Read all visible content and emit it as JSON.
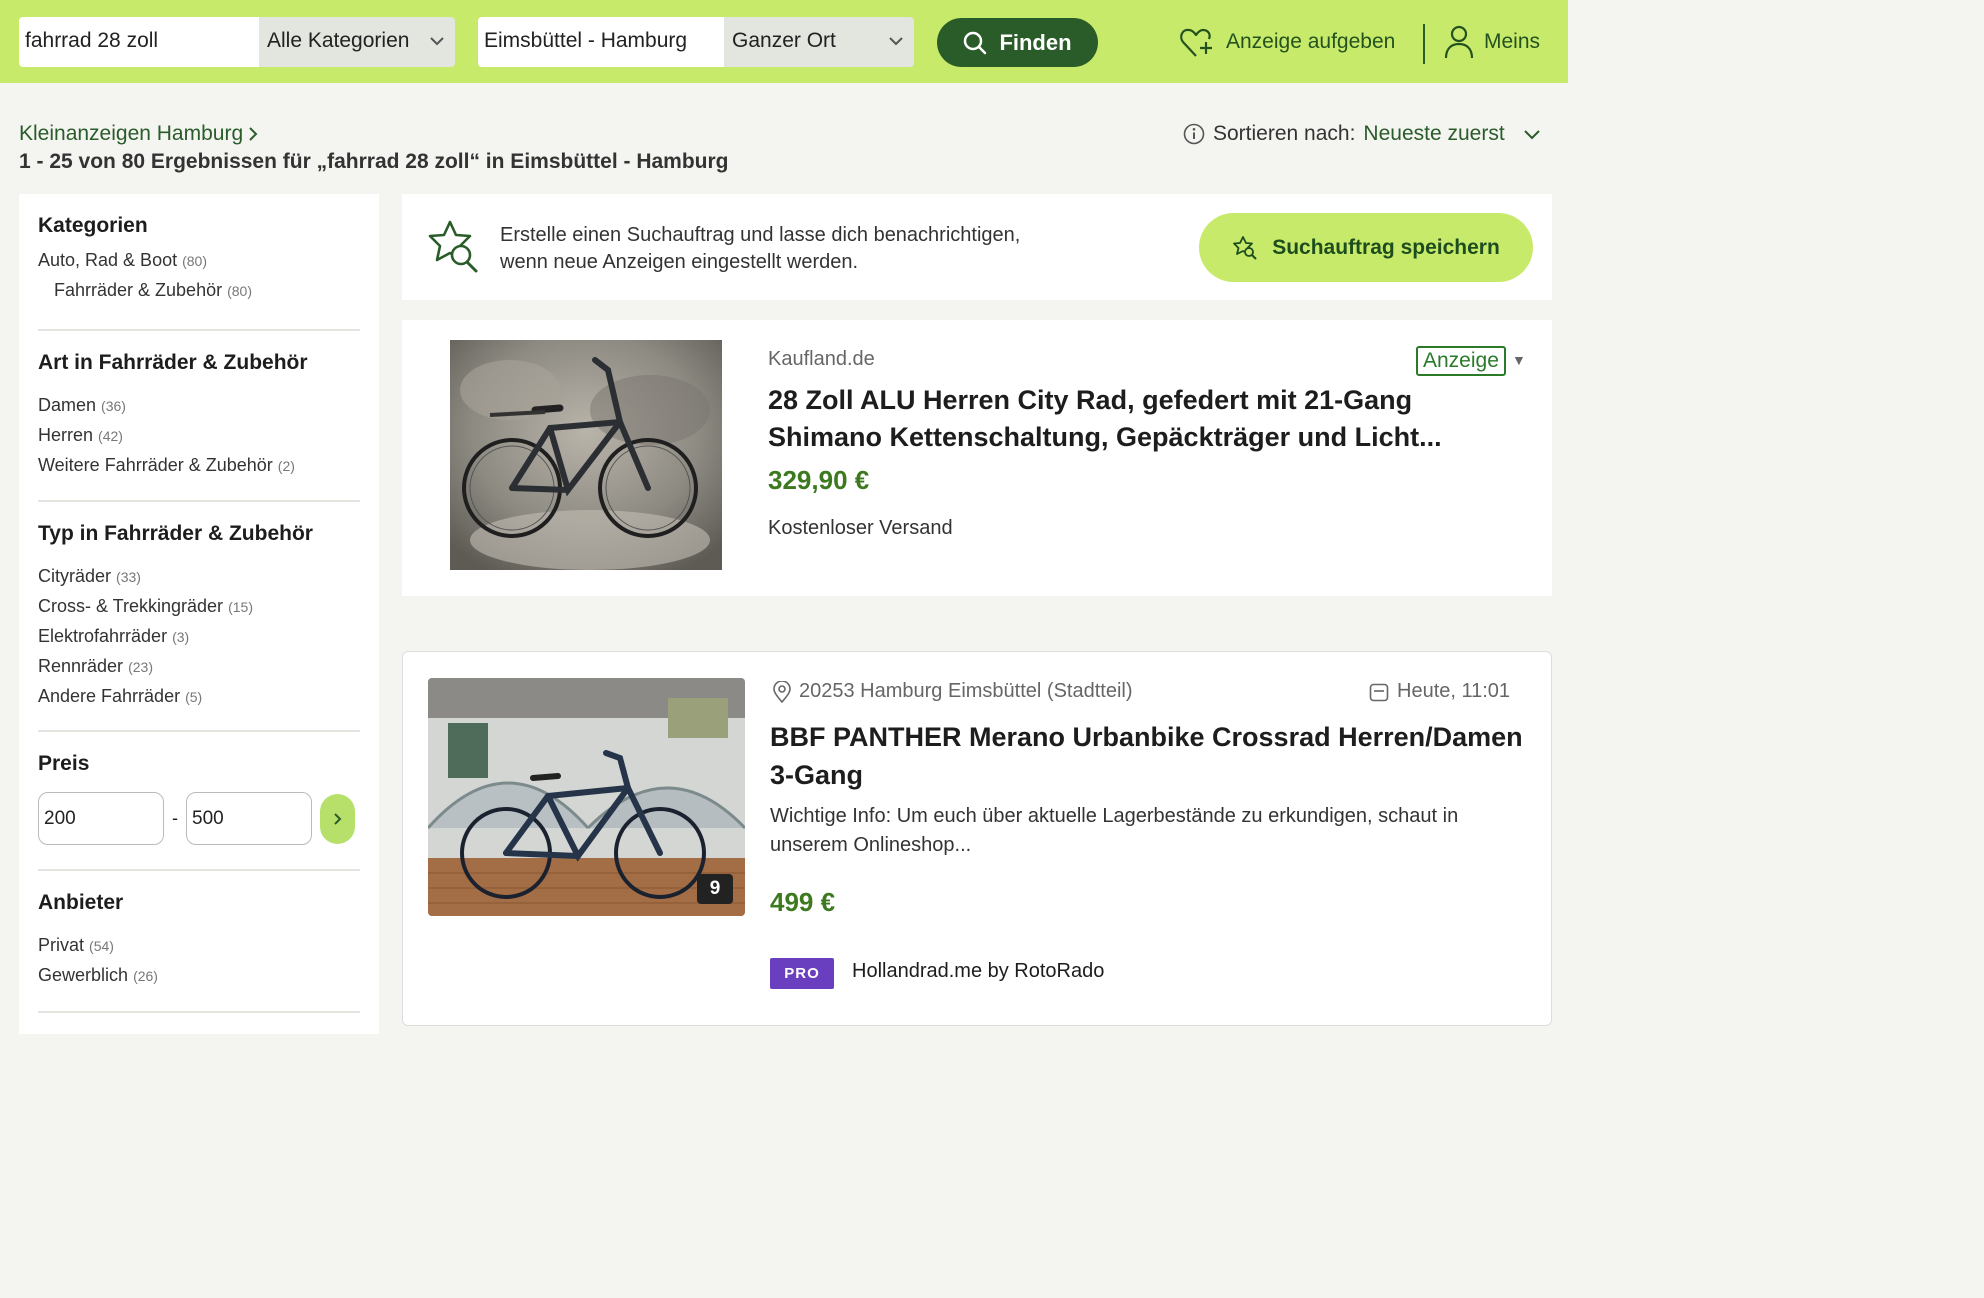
{
  "header": {
    "search_value": "fahrrad 28 zoll",
    "category": "Alle Kategorien",
    "location": "Eimsbüttel - Hamburg",
    "radius": "Ganzer Ort",
    "find_label": "Finden",
    "post_ad_label": "Anzeige aufgeben",
    "account_label": "Meins"
  },
  "breadcrumb": {
    "link": "Kleinanzeigen Hamburg",
    "result_title": "1 - 25 von 80 Ergebnissen für „fahrrad 28 zoll“ in Eimsbüttel - Hamburg"
  },
  "sort": {
    "label": "Sortieren nach:",
    "value": "Neueste zuerst"
  },
  "sidebar": {
    "categories": {
      "title": "Kategorien",
      "items": [
        {
          "label": "Auto, Rad & Boot",
          "count": "(80)"
        },
        {
          "label": "Fahrräder & Zubehör",
          "count": "(80)"
        }
      ]
    },
    "art": {
      "title": "Art in Fahrräder & Zubehör",
      "items": [
        {
          "label": "Damen",
          "count": "(36)"
        },
        {
          "label": "Herren",
          "count": "(42)"
        },
        {
          "label": "Weitere Fahrräder & Zubehör",
          "count": "(2)"
        }
      ]
    },
    "typ": {
      "title": "Typ in Fahrräder & Zubehör",
      "items": [
        {
          "label": "Cityräder",
          "count": "(33)"
        },
        {
          "label": "Cross- & Trekkingräder",
          "count": "(15)"
        },
        {
          "label": "Elektrofahrräder",
          "count": "(3)"
        },
        {
          "label": "Rennräder",
          "count": "(23)"
        },
        {
          "label": "Andere Fahrräder",
          "count": "(5)"
        }
      ]
    },
    "price": {
      "title": "Preis",
      "min": "200",
      "sep": "-",
      "max": "500"
    },
    "seller": {
      "title": "Anbieter",
      "items": [
        {
          "label": "Privat",
          "count": "(54)"
        },
        {
          "label": "Gewerblich",
          "count": "(26)"
        }
      ]
    }
  },
  "alert": {
    "line1": "Erstelle einen Suchauftrag und lasse dich benachrichtigen,",
    "line2": "wenn neue Anzeigen eingestellt werden.",
    "button": "Suchauftrag speichern"
  },
  "ad": {
    "seller": "Kaufland.de",
    "badge": "Anzeige",
    "title": "28 Zoll ALU Herren City Rad, gefedert mit 21-Gang Shimano Kettenschaltung, Gepäckträger und Licht...",
    "price": "329,90 €",
    "shipping": "Kostenloser Versand"
  },
  "listing": {
    "location": "20253 Hamburg Eimsbüttel (Stadtteil)",
    "date": "Heute, 11:01",
    "title": "BBF PANTHER Merano Urbanbike Crossrad Herren/Damen 3-Gang",
    "description": "Wichtige Info: Um euch über aktuelle Lagerbestände zu erkundigen, schaut in unserem Onlineshop...",
    "price": "499 €",
    "image_count": "9",
    "pro_badge": "PRO",
    "pro_name": "Hollandrad.me by RotoRado"
  },
  "colors": {
    "header_bg": "#c8ea6a",
    "brand_dark": "#2a5c2a",
    "price_green": "#3d7a1f",
    "pro_purple": "#6a3fbf"
  }
}
